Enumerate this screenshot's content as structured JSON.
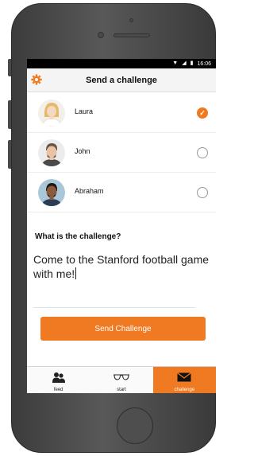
{
  "status_bar": {
    "time": "16:06",
    "wifi_icon": "wifi-icon",
    "signal_icon": "signal-icon",
    "battery_icon": "battery-icon"
  },
  "header": {
    "title": "Send a challenge",
    "settings_icon": "gear-icon"
  },
  "contacts": [
    {
      "name": "Laura",
      "selected": true
    },
    {
      "name": "John",
      "selected": false
    },
    {
      "name": "Abraham",
      "selected": false
    }
  ],
  "challenge": {
    "question": "What is the challenge?",
    "text": "Come to the Stanford football game with me!"
  },
  "send_button": {
    "label": "Send Challenge"
  },
  "tabs": [
    {
      "label": "feed",
      "icon": "people-icon",
      "active": false
    },
    {
      "label": "start",
      "icon": "glasses-icon",
      "active": false
    },
    {
      "label": "challenge",
      "icon": "envelope-icon",
      "active": true
    }
  ],
  "colors": {
    "accent": "#f07a21",
    "header_bg": "#f4f4f4"
  }
}
